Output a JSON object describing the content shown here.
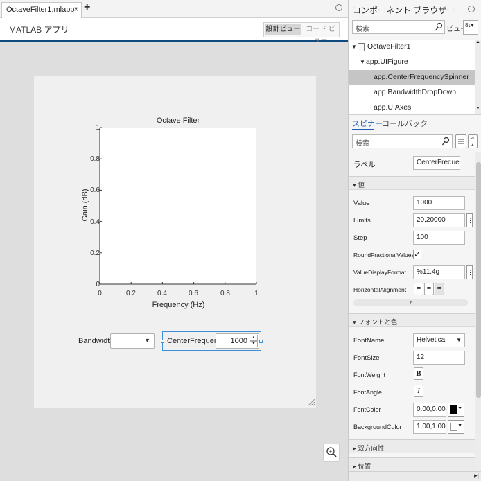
{
  "tab": {
    "title": "OctaveFilter1.mlapp*",
    "close": "×",
    "add": "+"
  },
  "toolbar": {
    "app_title": "MATLAB アプリ",
    "design_view": "設計ビュー",
    "code_view": "コード ビュー"
  },
  "axes": {
    "title": "Octave Filter",
    "xlabel": "Frequency (Hz)",
    "ylabel": "Gain (dB)",
    "xticks": [
      "0",
      "0.2",
      "0.4",
      "0.6",
      "0.8",
      "1"
    ],
    "yticks": [
      "0",
      "0.2",
      "0.4",
      "0.6",
      "0.8",
      "1"
    ]
  },
  "controls": {
    "bandwidth_label": "Bandwidth",
    "bandwidth_value": "",
    "center_label": "CenterFrequency",
    "center_value": "1000"
  },
  "browser": {
    "title": "コンポーネント ブラウザー",
    "search_placeholder": "検索",
    "view_label": "ビュー",
    "tree": [
      {
        "label": "OctaveFilter1"
      },
      {
        "label": "app.UIFigure"
      },
      {
        "label": "app.CenterFrequencySpinner"
      },
      {
        "label": "app.BandwidthDropDown"
      },
      {
        "label": "app.UIAxes"
      }
    ]
  },
  "inspector": {
    "tab_spinner": "スピナー",
    "tab_separator": "|",
    "tab_callback": "コールバック",
    "search_placeholder": "検索",
    "label_name": "ラベル",
    "label_value": "CenterFrequency",
    "section_value": "値",
    "section_font": "フォントと色",
    "section_interact": "双方向性",
    "section_position": "位置",
    "props": {
      "Value": "1000",
      "Limits": "20,20000",
      "Step": "100",
      "RoundFractionalValues": "RoundFractionalValues",
      "ValueDisplayFormat": "%11.4g",
      "HorizontalAlignment": "HorizontalAlignment",
      "FontName": "Helvetica",
      "FontSize": "12",
      "FontWeight": "FontWeight",
      "FontAngle": "FontAngle",
      "FontColor": "0.00,0.00",
      "BackgroundColor": "1.00,1.00"
    },
    "prop_labels": {
      "value": "Value",
      "limits": "Limits",
      "step": "Step",
      "round": "RoundFractionalValues",
      "format": "ValueDisplayFormat",
      "halign": "HorizontalAlignment",
      "fontname": "FontName",
      "fontsize": "FontSize",
      "fontweight": "FontWeight",
      "fontangle": "FontAngle",
      "fontcolor": "FontColor",
      "bgcolor": "BackgroundColor"
    },
    "bold_glyph": "B",
    "italic_glyph": "I",
    "check_glyph": "✓"
  },
  "colors": {
    "accent": "#0e4a7e",
    "selection": "#c5c5c5",
    "link": "#1a5fb4",
    "font_color_swatch": "#000000",
    "bg_color_swatch": "#ffffff"
  }
}
